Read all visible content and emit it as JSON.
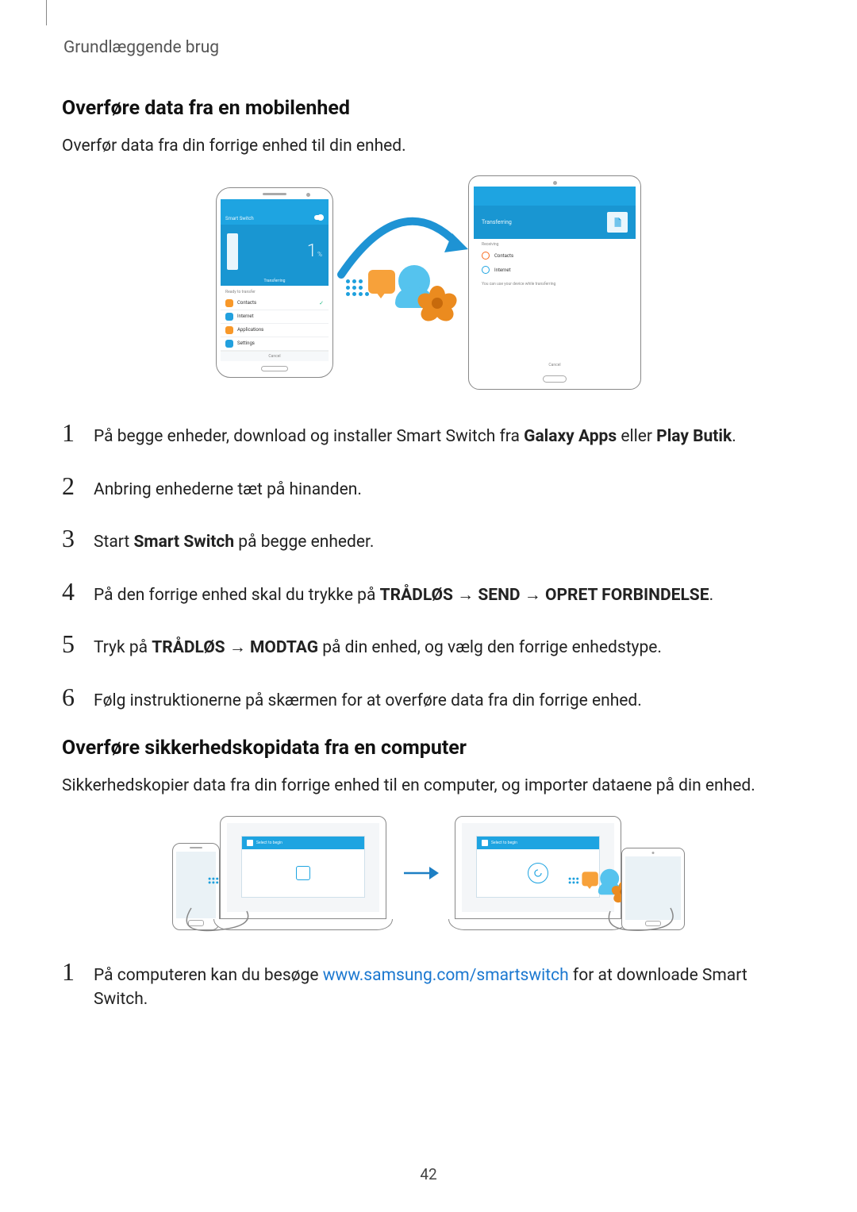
{
  "header": {
    "breadcrumb": "Grundlæggende brug"
  },
  "section1": {
    "heading": "Overføre data fra en mobilenhed",
    "intro": "Overfør data fra din forrige enhed til din enhed."
  },
  "steps1": [
    {
      "n": "1",
      "pre": "På begge enheder, download og installer Smart Switch fra ",
      "b1": "Galaxy Apps",
      "mid": " eller ",
      "b2": "Play Butik",
      "post": "."
    },
    {
      "n": "2",
      "text": "Anbring enhederne tæt på hinanden."
    },
    {
      "n": "3",
      "pre": "Start ",
      "b1": "Smart Switch",
      "post": " på begge enheder."
    },
    {
      "n": "4",
      "pre": "På den forrige enhed skal du trykke på ",
      "b1": "TRÅDLØS",
      "arrow1": " → ",
      "b2": "SEND",
      "arrow2": " → ",
      "b3": "OPRET FORBINDELSE",
      "post": "."
    },
    {
      "n": "5",
      "pre": "Tryk på ",
      "b1": "TRÅDLØS",
      "arrow1": " → ",
      "b2": "MODTAG",
      "post": " på din enhed, og vælg den forrige enhedstype."
    },
    {
      "n": "6",
      "text": "Følg instruktionerne på skærmen for at overføre data fra din forrige enhed."
    }
  ],
  "section2": {
    "heading": "Overføre sikkerhedskopidata fra en computer",
    "intro": "Sikkerhedskopier data fra din forrige enhed til en computer, og importer dataene på din enhed."
  },
  "steps2": [
    {
      "n": "1",
      "pre": "På computeren kan du besøge ",
      "link": "www.samsung.com/smartswitch",
      "post": " for at downloade Smart Switch."
    }
  ],
  "figure": {
    "phone": {
      "topLabel": "Smart Switch",
      "pctNum": "1",
      "pctUnit": "%",
      "subLabel": "Transferring",
      "listHeader": "Ready to transfer",
      "items": [
        {
          "label": "Contacts",
          "color": "orange",
          "check": true
        },
        {
          "label": "Internet",
          "color": "blue"
        },
        {
          "label": "Applications",
          "color": "orange"
        },
        {
          "label": "Settings",
          "color": "blue"
        }
      ],
      "footer": "Cancel"
    },
    "tablet": {
      "rowLabel": "Transferring",
      "subheader": "Receiving",
      "items": [
        {
          "label": "Contacts",
          "color": "orange"
        },
        {
          "label": "Internet",
          "color": "blue"
        }
      ],
      "bodyNote": "You can use your device while transferring",
      "footer": "Cancel"
    }
  },
  "figure2": {
    "laptopAppLabel": "Select to begin"
  },
  "pageNumber": "42"
}
